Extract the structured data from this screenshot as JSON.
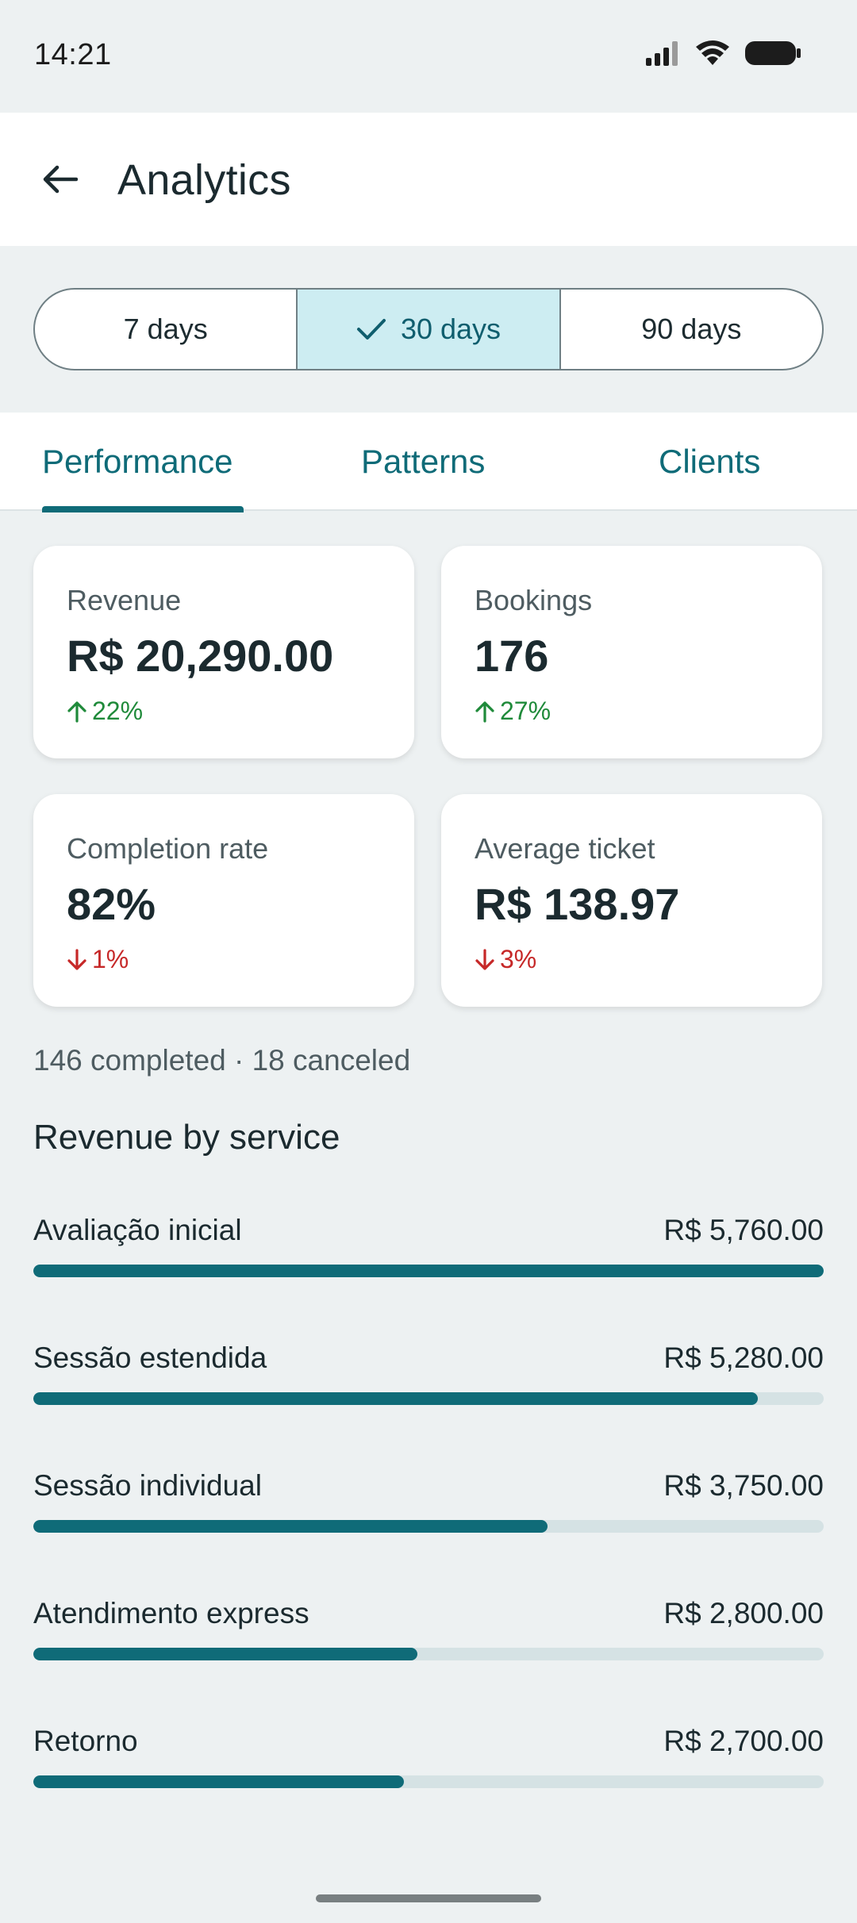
{
  "status": {
    "time": "14:21"
  },
  "header": {
    "title": "Analytics"
  },
  "range": {
    "options": [
      "7 days",
      "30 days",
      "90 days"
    ],
    "selected_index": 1
  },
  "tabs": [
    "Performance",
    "Patterns",
    "Clients"
  ],
  "active_tab": 0,
  "metrics": [
    {
      "label": "Revenue",
      "value": "R$ 20,290.00",
      "delta": "22%",
      "direction": "up"
    },
    {
      "label": "Bookings",
      "value": "176",
      "delta": "27%",
      "direction": "up"
    },
    {
      "label": "Completion rate",
      "value": "82%",
      "delta": "1%",
      "direction": "down"
    },
    {
      "label": "Average ticket",
      "value": "R$ 138.97",
      "delta": "3%",
      "direction": "down"
    }
  ],
  "summary": "146 completed · 18 canceled",
  "revenue_by_service": {
    "title": "Revenue by service",
    "items": [
      {
        "name": "Avaliação inicial",
        "amount": "R$ 5,760.00",
        "fraction": 1.0
      },
      {
        "name": "Sessão estendida",
        "amount": "R$ 5,280.00",
        "fraction": 0.917
      },
      {
        "name": "Sessão individual",
        "amount": "R$ 3,750.00",
        "fraction": 0.651
      },
      {
        "name": "Atendimento express",
        "amount": "R$ 2,800.00",
        "fraction": 0.486
      },
      {
        "name": "Retorno",
        "amount": "R$ 2,700.00",
        "fraction": 0.469
      }
    ]
  },
  "colors": {
    "accent": "#0f6b78",
    "selected_segment": "#cdedf2",
    "positive": "#1f8a3a",
    "negative": "#c62828",
    "background": "#edf1f2"
  }
}
